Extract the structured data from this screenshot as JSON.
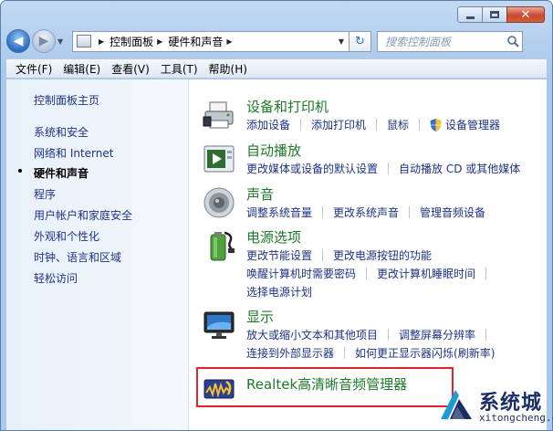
{
  "window": {
    "caption_buttons": [
      "minimize",
      "maximize",
      "close"
    ]
  },
  "navbar": {
    "breadcrumbs": [
      "控制面板",
      "硬件和声音"
    ],
    "search_placeholder": "搜索控制面板"
  },
  "menu": [
    "文件(F)",
    "编辑(E)",
    "查看(V)",
    "工具(T)",
    "帮助(H)"
  ],
  "left_nav": {
    "home": "控制面板主页",
    "items": [
      "系统和安全",
      "网络和 Internet",
      "硬件和声音",
      "程序",
      "用户帐户和家庭安全",
      "外观和个性化",
      "时钟、语言和区域",
      "轻松访问"
    ],
    "active_index": 2
  },
  "categories": [
    {
      "title": "设备和打印机",
      "icon": "printer-icon",
      "lines": [
        [
          "添加设备",
          "添加打印机",
          "鼠标",
          "设备管理器"
        ]
      ]
    },
    {
      "title": "自动播放",
      "icon": "autoplay-icon",
      "lines": [
        [
          "更改媒体或设备的默认设置",
          "自动播放 CD 或其他媒体"
        ]
      ]
    },
    {
      "title": "声音",
      "icon": "speaker-icon",
      "lines": [
        [
          "调整系统音量",
          "更改系统声音",
          "管理音频设备"
        ]
      ]
    },
    {
      "title": "电源选项",
      "icon": "battery-icon",
      "lines": [
        [
          "更改节能设置",
          "更改电源按钮的功能"
        ],
        [
          "唤醒计算机时需要密码",
          "更改计算机睡眠时间"
        ],
        [
          "选择电源计划"
        ]
      ]
    },
    {
      "title": "显示",
      "icon": "monitor-icon",
      "lines": [
        [
          "放大或缩小文本和其他项目",
          "调整屏幕分辨率"
        ],
        [
          "连接到外部显示器",
          "如何更正显示器闪烁(刷新率)"
        ]
      ]
    }
  ],
  "realtek": {
    "title": "Realtek高清晰音频管理器",
    "icon": "realtek-audio-icon"
  },
  "watermark": {
    "text": "系统城",
    "url": "xitongcheng.com"
  },
  "colors": {
    "category_title": "#1e7a2a",
    "link": "#1e3287",
    "highlight": "#e0262b"
  }
}
